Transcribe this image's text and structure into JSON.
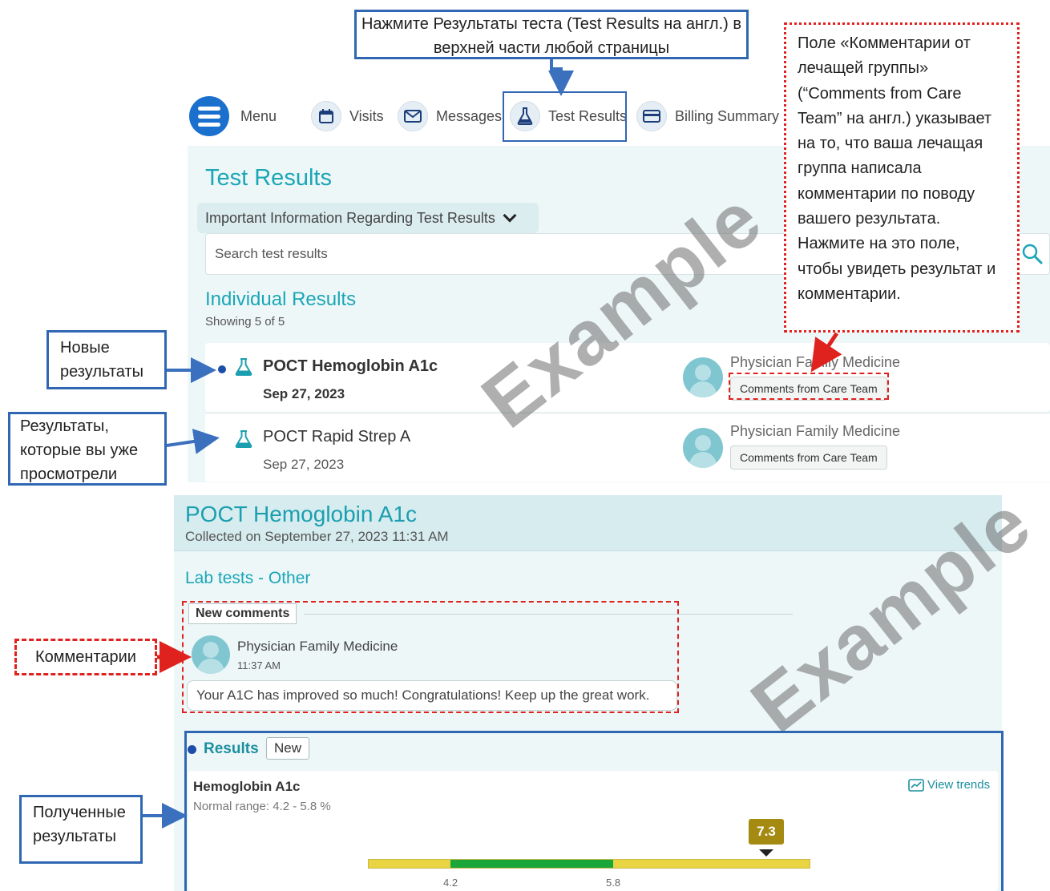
{
  "annotations": {
    "top_instruction": "Нажмите Результаты теста (Test Results на англ.) в верхней части любой страницы",
    "comments_field_note": "Поле «Комментарии от лечащей группы» (“Comments from Care Team” на англ.) указывает на то, что ваша лечащая группа написала комментарии по поводу вашего результата. Нажмите на это поле, чтобы увидеть результат и комментарии.",
    "new_results": "Новые результаты",
    "viewed_results": "Результаты, которые вы уже просмотрели",
    "comments": "Комментарии",
    "received_results": "Полученные результаты",
    "watermark": "Example"
  },
  "navbar": {
    "items": [
      {
        "label": "Menu",
        "icon": "menu-icon"
      },
      {
        "label": "Visits",
        "icon": "calendar-icon"
      },
      {
        "label": "Messages",
        "icon": "envelope-icon"
      },
      {
        "label": "Test Results",
        "icon": "flask-icon"
      },
      {
        "label": "Billing Summary",
        "icon": "credit-card-icon"
      }
    ]
  },
  "test_results_page": {
    "title": "Test Results",
    "info_toggle": "Important Information Regarding Test Results",
    "search_placeholder": "Search test results",
    "section_title": "Individual Results",
    "showing": "Showing 5 of 5",
    "rows": [
      {
        "name": "POCT Hemoglobin A1c",
        "date": "Sep 27, 2023",
        "provider": "Physician Family Medicine",
        "button": "Comments from Care Team",
        "is_new": true
      },
      {
        "name": "POCT Rapid Strep A",
        "date": "Sep 27, 2023",
        "provider": "Physician Family Medicine",
        "button": "Comments from Care Team",
        "is_new": false
      }
    ]
  },
  "detail_page": {
    "title": "POCT Hemoglobin A1c",
    "collected": "Collected on September 27, 2023 11:31 AM",
    "category": "Lab tests - Other",
    "new_comments_tag": "New comments",
    "comment": {
      "author": "Physician Family Medicine",
      "time": "11:37 AM",
      "text": "Your A1C has improved so much! Congratulations! Keep up the great work."
    },
    "results_label": "Results",
    "results_tag": "New",
    "component": {
      "name": "Hemoglobin A1c",
      "normal_range": "Normal range: 4.2 - 5.8 %",
      "view_trends": "View trends",
      "value": "7.3",
      "range_low": "4.2",
      "range_high": "5.8"
    }
  },
  "colors": {
    "accent_teal": "#1ba6b6",
    "nav_blue": "#1b6fcd",
    "callout_blue": "#2f67b3",
    "callout_red": "#e0221f",
    "range_normal": "#1ba63a",
    "range_abnormal": "#e9d542",
    "value_badge": "#a58a12"
  }
}
